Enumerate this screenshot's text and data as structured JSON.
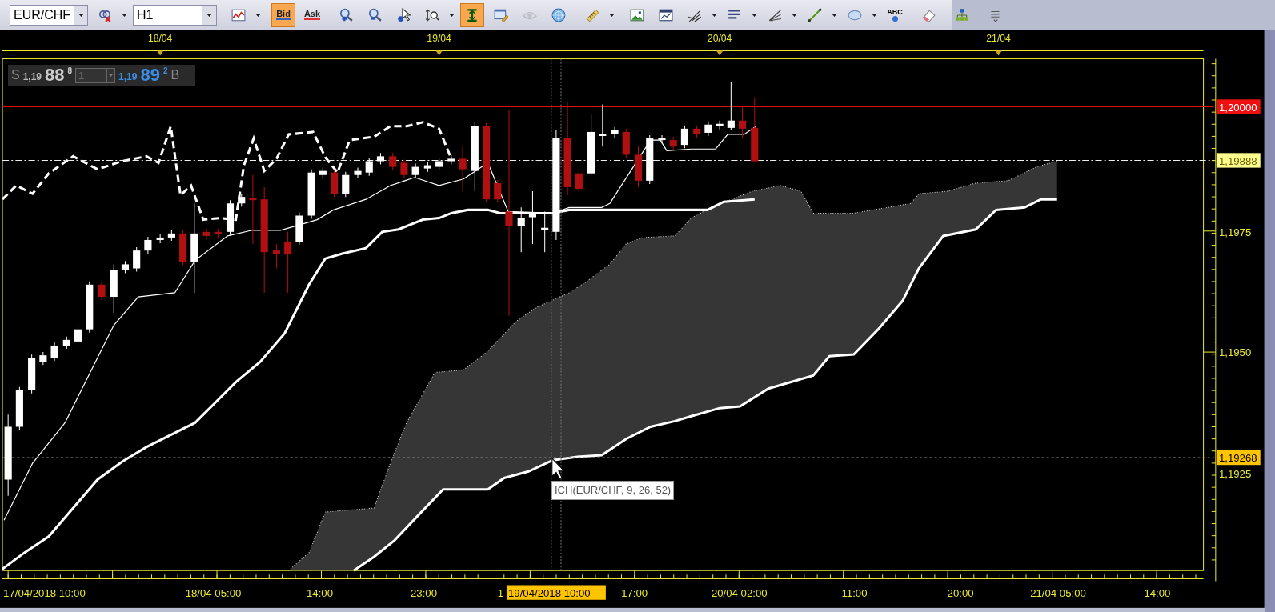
{
  "toolbar": {
    "groups": [
      [
        {
          "kind": "combo",
          "value": "EUR/CHF"
        },
        {
          "kind": "icon",
          "menu": true,
          "active": false,
          "disabled": false
        },
        {
          "kind": "combo",
          "value": "H1"
        }
      ],
      [
        {
          "kind": "icon",
          "menu": true,
          "active": false,
          "disabled": false
        }
      ],
      [
        {
          "kind": "toggle",
          "label": "Bid",
          "selected": true
        },
        {
          "kind": "toggle",
          "label": "Ask",
          "selected": false
        }
      ],
      [
        {
          "kind": "icon",
          "menu": false,
          "active": false,
          "disabled": false
        },
        {
          "kind": "icon",
          "menu": false,
          "active": false,
          "disabled": false
        },
        {
          "kind": "icon",
          "menu": false,
          "active": false,
          "disabled": false
        },
        {
          "kind": "icon",
          "menu": true,
          "active": false,
          "disabled": false
        },
        {
          "kind": "icon",
          "menu": false,
          "active": true,
          "disabled": false
        },
        {
          "kind": "icon",
          "menu": false,
          "active": false,
          "disabled": false
        },
        {
          "kind": "icon",
          "menu": false,
          "active": false,
          "disabled": true
        },
        {
          "kind": "icon",
          "menu": false,
          "active": false,
          "disabled": false
        }
      ],
      [
        {
          "kind": "icon",
          "menu": true,
          "active": false,
          "disabled": false
        }
      ],
      [
        {
          "kind": "icon",
          "menu": false,
          "active": false,
          "disabled": false
        },
        {
          "kind": "icon",
          "menu": false,
          "active": false,
          "disabled": false
        },
        {
          "kind": "icon",
          "menu": true,
          "active": false,
          "disabled": false
        },
        {
          "kind": "icon",
          "menu": true,
          "active": false,
          "disabled": false
        },
        {
          "kind": "icon",
          "menu": true,
          "active": false,
          "disabled": false
        },
        {
          "kind": "icon",
          "menu": true,
          "active": false,
          "disabled": false
        },
        {
          "kind": "icon",
          "menu": true,
          "active": false,
          "disabled": false
        },
        {
          "kind": "icon",
          "menu": false,
          "active": false,
          "disabled": false,
          "label": "ABC"
        }
      ],
      [
        {
          "kind": "icon",
          "menu": false,
          "active": false,
          "disabled": false
        }
      ],
      [
        {
          "kind": "icon",
          "menu": false,
          "active": false,
          "disabled": false
        }
      ],
      [
        {
          "kind": "icon",
          "menu": false,
          "active": false,
          "disabled": false
        }
      ]
    ]
  },
  "chart": {
    "quote": {
      "sell_label": "S",
      "sell_big_figure": "1,19",
      "sell_pips": "88",
      "sell_fraction": "8",
      "quantity": "1",
      "buy_big_figure": "1,19",
      "buy_pips": "89",
      "buy_fraction": "2",
      "buy_label": "B"
    },
    "date_labels": [
      "18/04",
      "19/04",
      "20/04",
      "21/04"
    ],
    "price_labels": [
      {
        "text": "1,20000",
        "kind": "ask"
      },
      {
        "text": "1,19888",
        "kind": "bid"
      },
      {
        "text": "1,1975",
        "kind": "tick"
      },
      {
        "text": "1,1950",
        "kind": "tick"
      },
      {
        "text": "1,19268",
        "kind": "cursor"
      },
      {
        "text": "1,1925",
        "kind": "tick"
      }
    ],
    "time_labels": [
      {
        "text": "17/04/2018 10:00",
        "kind": "tick"
      },
      {
        "text": "18/04 05:00",
        "kind": "tick"
      },
      {
        "text": "14:00",
        "kind": "tick"
      },
      {
        "text": "23:00",
        "kind": "tick"
      },
      {
        "text": "1",
        "kind": "tick"
      },
      {
        "text": "19/04/2018 10:00",
        "kind": "cursor"
      },
      {
        "text": "17:00",
        "kind": "tick"
      },
      {
        "text": "20/04 02:00",
        "kind": "tick"
      },
      {
        "text": "11:00",
        "kind": "tick"
      },
      {
        "text": "20:00",
        "kind": "tick"
      },
      {
        "text": "21/04 05:00",
        "kind": "tick"
      },
      {
        "text": "14:00",
        "kind": "tick"
      }
    ],
    "tooltip": "ICH(EUR/CHF, 9, 26, 52)"
  }
}
